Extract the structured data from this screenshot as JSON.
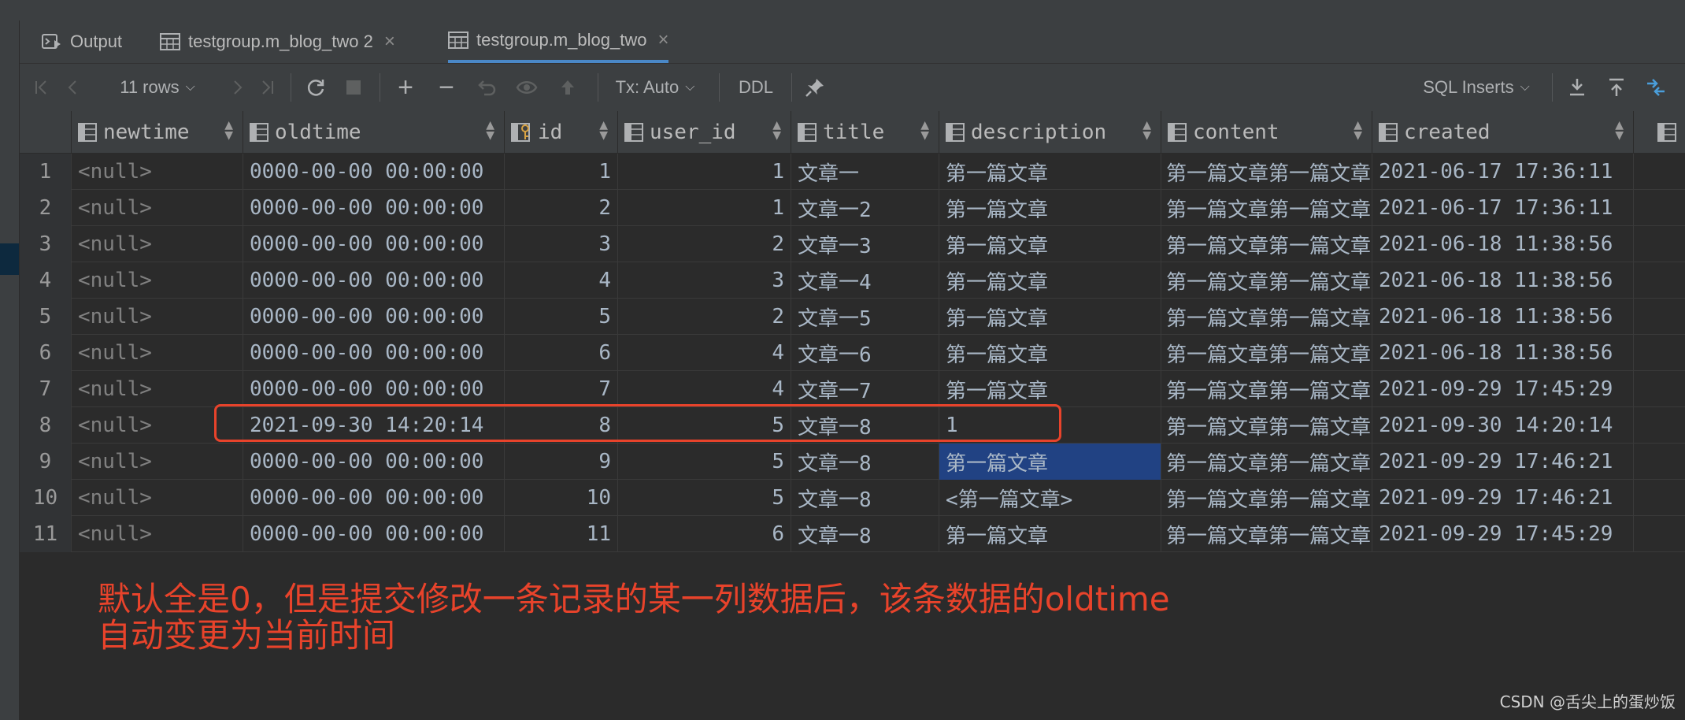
{
  "tabs": [
    {
      "label": "Output",
      "icon": "console-run-icon",
      "active": false,
      "closable": false
    },
    {
      "label": "testgroup.m_blog_two 2",
      "icon": "table-icon",
      "active": false,
      "closable": true
    },
    {
      "label": "testgroup.m_blog_two",
      "icon": "table-icon",
      "active": true,
      "closable": true
    }
  ],
  "toolbar": {
    "rows_label": "11 rows",
    "tx_label": "Tx: Auto",
    "ddl_label": "DDL",
    "export_format": "SQL Inserts"
  },
  "columns": [
    {
      "label": "newtime",
      "icon": "column-icon"
    },
    {
      "label": "oldtime",
      "icon": "column-icon"
    },
    {
      "label": "id",
      "icon": "primary-key-column-icon"
    },
    {
      "label": "user_id",
      "icon": "column-icon"
    },
    {
      "label": "title",
      "icon": "column-icon"
    },
    {
      "label": "description",
      "icon": "column-icon"
    },
    {
      "label": "content",
      "icon": "column-icon"
    },
    {
      "label": "created",
      "icon": "column-icon"
    }
  ],
  "rows": [
    {
      "n": "1",
      "newtime": "<null>",
      "oldtime": "0000-00-00 00:00:00",
      "id": "1",
      "user_id": "1",
      "title": "文章一",
      "description": "第一篇文章",
      "content": "第一篇文章第一篇文章",
      "created": "2021-06-17 17:36:11"
    },
    {
      "n": "2",
      "newtime": "<null>",
      "oldtime": "0000-00-00 00:00:00",
      "id": "2",
      "user_id": "1",
      "title": "文章一2",
      "description": "第一篇文章",
      "content": "第一篇文章第一篇文章",
      "created": "2021-06-17 17:36:11"
    },
    {
      "n": "3",
      "newtime": "<null>",
      "oldtime": "0000-00-00 00:00:00",
      "id": "3",
      "user_id": "2",
      "title": "文章一3",
      "description": "第一篇文章",
      "content": "第一篇文章第一篇文章",
      "created": "2021-06-18 11:38:56"
    },
    {
      "n": "4",
      "newtime": "<null>",
      "oldtime": "0000-00-00 00:00:00",
      "id": "4",
      "user_id": "3",
      "title": "文章一4",
      "description": "第一篇文章",
      "content": "第一篇文章第一篇文章",
      "created": "2021-06-18 11:38:56"
    },
    {
      "n": "5",
      "newtime": "<null>",
      "oldtime": "0000-00-00 00:00:00",
      "id": "5",
      "user_id": "2",
      "title": "文章一5",
      "description": "第一篇文章",
      "content": "第一篇文章第一篇文章",
      "created": "2021-06-18 11:38:56"
    },
    {
      "n": "6",
      "newtime": "<null>",
      "oldtime": "0000-00-00 00:00:00",
      "id": "6",
      "user_id": "4",
      "title": "文章一6",
      "description": "第一篇文章",
      "content": "第一篇文章第一篇文章",
      "created": "2021-06-18 11:38:56"
    },
    {
      "n": "7",
      "newtime": "<null>",
      "oldtime": "0000-00-00 00:00:00",
      "id": "7",
      "user_id": "4",
      "title": "文章一7",
      "description": "第一篇文章",
      "content": "第一篇文章第一篇文章",
      "created": "2021-09-29 17:45:29"
    },
    {
      "n": "8",
      "newtime": "<null>",
      "oldtime": "2021-09-30 14:20:14",
      "id": "8",
      "user_id": "5",
      "title": "文章一8",
      "description": "1",
      "content": "第一篇文章第一篇文章",
      "created": "2021-09-30 14:20:14"
    },
    {
      "n": "9",
      "newtime": "<null>",
      "oldtime": "0000-00-00 00:00:00",
      "id": "9",
      "user_id": "5",
      "title": "文章一8",
      "description": "第一篇文章",
      "content": "第一篇文章第一篇文章",
      "created": "2021-09-29 17:46:21"
    },
    {
      "n": "10",
      "newtime": "<null>",
      "oldtime": "0000-00-00 00:00:00",
      "id": "10",
      "user_id": "5",
      "title": "文章一8",
      "description": "<第一篇文章>",
      "content": "第一篇文章第一篇文章",
      "created": "2021-09-29 17:46:21"
    },
    {
      "n": "11",
      "newtime": "<null>",
      "oldtime": "0000-00-00 00:00:00",
      "id": "11",
      "user_id": "6",
      "title": "文章一8",
      "description": "第一篇文章",
      "content": "第一篇文章第一篇文章",
      "created": "2021-09-29 17:45:29"
    }
  ],
  "selected_cell": {
    "row": "9",
    "column": "description"
  },
  "annotation": {
    "line1": "默认全是0，但是提交修改一条记录的某一列数据后，该条数据的oldtime",
    "line2": "自动变更为当前时间",
    "color": "#e8432b"
  },
  "watermark": "CSDN @舌尖上的蛋炒饭",
  "colors": {
    "background": "#2b2b2b",
    "panel": "#3c3f41",
    "selection": "#214283",
    "accent": "#4a88c7"
  }
}
